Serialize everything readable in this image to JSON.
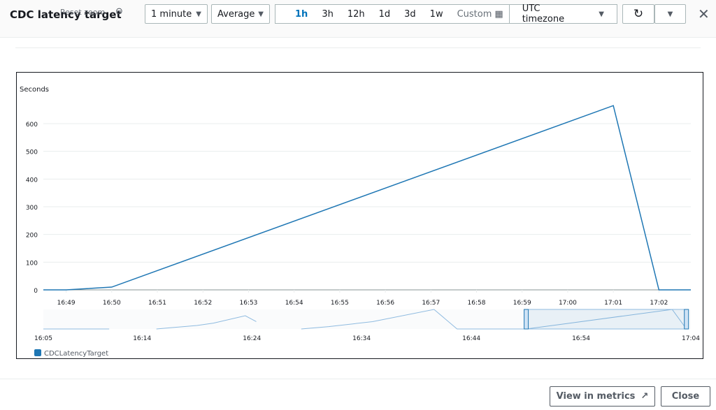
{
  "header": {
    "title": "CDC latency target",
    "reset_zoom": "Reset zoom",
    "period": "1 minute",
    "statistic": "Average",
    "ranges": [
      "1h",
      "3h",
      "12h",
      "1d",
      "3d",
      "1w"
    ],
    "active_range": "1h",
    "custom": "Custom",
    "timezone": "UTC timezone"
  },
  "footer": {
    "view_in_metrics": "View in metrics",
    "close": "Close"
  },
  "chart_data": {
    "type": "line",
    "ylabel": "Seconds",
    "ylim": [
      0,
      600
    ],
    "yticks": [
      0,
      100,
      200,
      300,
      400,
      500,
      600
    ],
    "xticks": [
      "16:49",
      "16:50",
      "16:51",
      "16:52",
      "16:53",
      "16:54",
      "16:55",
      "16:56",
      "16:57",
      "16:58",
      "16:59",
      "17:00",
      "17:01",
      "17:02"
    ],
    "xrange": [
      "16:48.5",
      "17:02.7"
    ],
    "series": [
      {
        "name": "CDCLatencyTarget",
        "color": "#1f77b4",
        "points": [
          [
            "16:48.5",
            0
          ],
          [
            "16:49",
            0
          ],
          [
            "16:50",
            10
          ],
          [
            "17:01",
            665
          ],
          [
            "17:02",
            0
          ],
          [
            "17:02.7",
            0
          ]
        ]
      }
    ],
    "legend": "bottom-left",
    "navigator": {
      "xticks": [
        "16:05",
        "16:14",
        "16:24",
        "16:34",
        "16:44",
        "16:54",
        "17:04"
      ],
      "segments": [
        [
          [
            "16:05",
            0
          ],
          [
            "16:11",
            0
          ]
        ],
        [
          [
            "16:15.3",
            0
          ],
          [
            "16:19",
            120
          ],
          [
            "16:20.5",
            200
          ],
          [
            "16:23.4",
            450
          ],
          [
            "16:24.4",
            250
          ]
        ],
        [
          [
            "16:28.5",
            0
          ],
          [
            "16:31",
            80
          ],
          [
            "16:35",
            250
          ],
          [
            "16:40.6",
            665
          ],
          [
            "16:42.7",
            0
          ],
          [
            "16:49",
            0
          ]
        ],
        [
          [
            "16:49",
            0
          ],
          [
            "16:53",
            200
          ],
          [
            "17:02.3",
            665
          ],
          [
            "17:03.6",
            0
          ]
        ]
      ],
      "selection": [
        "16:49",
        "17:03.6"
      ]
    }
  }
}
